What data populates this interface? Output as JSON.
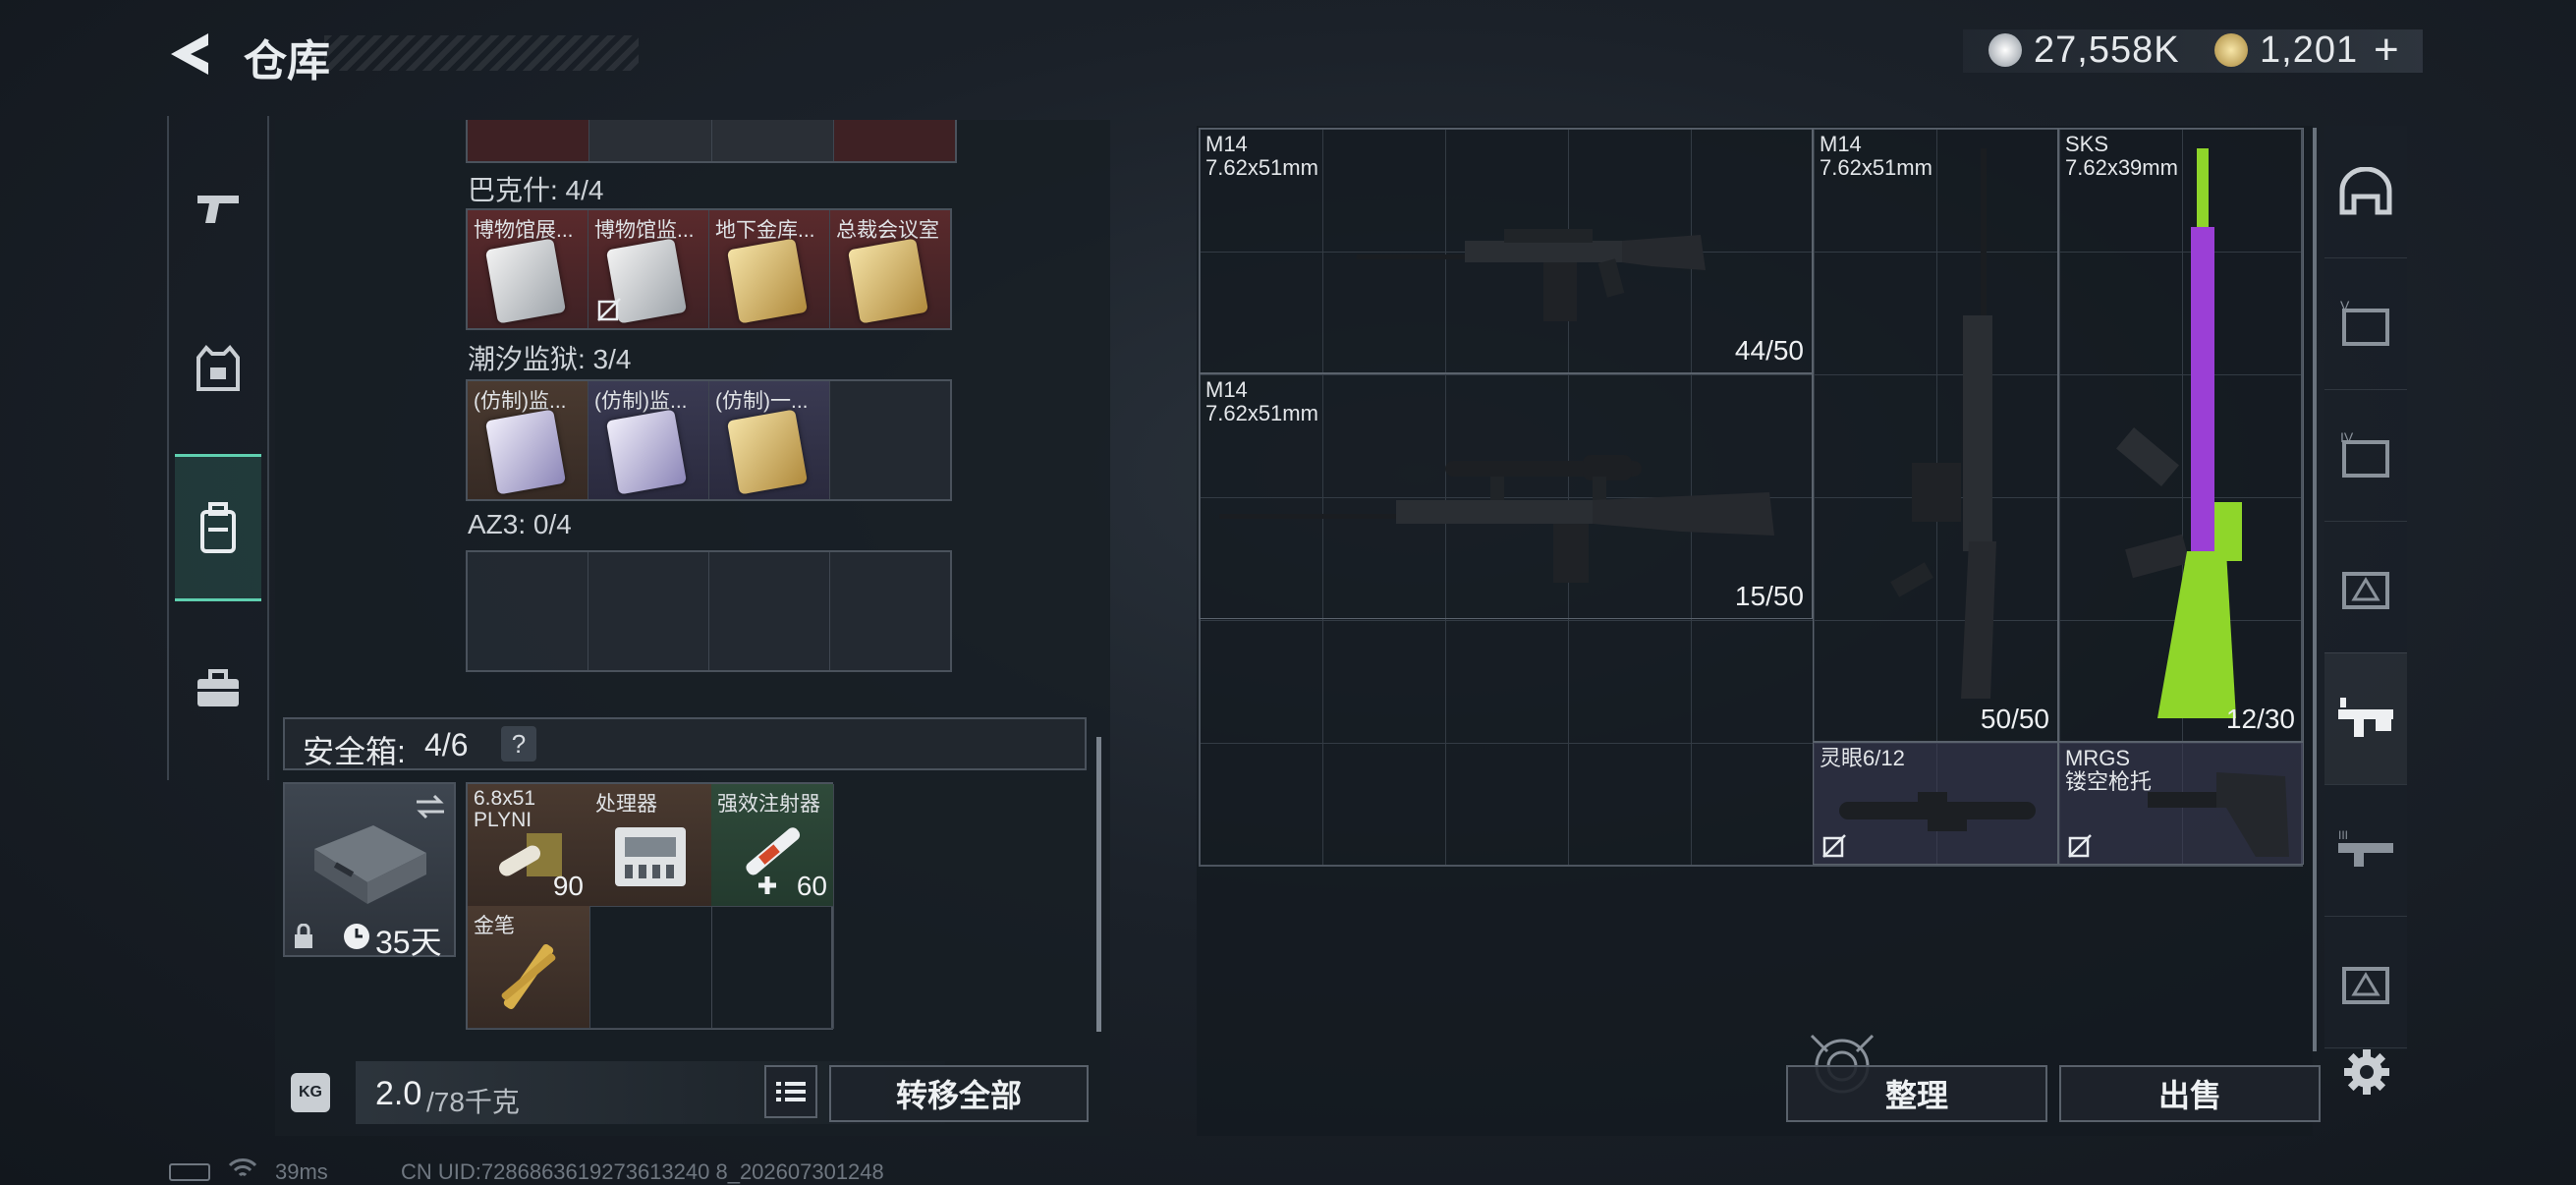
{
  "header": {
    "title": "仓库",
    "currency_silver": "27,558K",
    "currency_gold": "1,201",
    "add_symbol": "+"
  },
  "left_nav": [
    "weapon-tab",
    "armor-tab",
    "backpack-tab",
    "case-tab"
  ],
  "groups": [
    {
      "label": "巴克什: 4/4",
      "slots": [
        {
          "name": "博物馆展...",
          "color": "red",
          "card": "silver",
          "nolock": false
        },
        {
          "name": "博物馆监...",
          "color": "red",
          "card": "silver",
          "nolock": true
        },
        {
          "name": "地下金库...",
          "color": "red",
          "card": "gold",
          "nolock": false
        },
        {
          "name": "总裁会议室",
          "color": "red",
          "card": "gold",
          "nolock": false
        }
      ]
    },
    {
      "label": "潮汐监狱: 3/4",
      "slots": [
        {
          "name": "(仿制)监...",
          "color": "brown",
          "card": "lilac",
          "nolock": false
        },
        {
          "name": "(仿制)监...",
          "color": "purple",
          "card": "lilac",
          "nolock": false
        },
        {
          "name": "(仿制)一...",
          "color": "purple",
          "card": "gold",
          "nolock": false
        },
        {
          "name": "",
          "color": "empty",
          "card": "",
          "nolock": false
        }
      ]
    },
    {
      "label": "AZ3: 0/4",
      "slots": [
        {
          "name": "",
          "color": "empty",
          "card": "",
          "nolock": false
        },
        {
          "name": "",
          "color": "empty",
          "card": "",
          "nolock": false
        },
        {
          "name": "",
          "color": "empty",
          "card": "",
          "nolock": false
        },
        {
          "name": "",
          "color": "empty",
          "card": "",
          "nolock": false
        }
      ]
    }
  ],
  "safe": {
    "label": "安全箱:",
    "count": "4/6",
    "help": "?",
    "days": "35天",
    "items": [
      {
        "name": "6.8x51 PLYNI",
        "qty": "90"
      },
      {
        "name": "处理器",
        "qty": ""
      },
      {
        "name": "强效注射器",
        "qty": "60"
      },
      {
        "name": "金笔",
        "qty": ""
      }
    ]
  },
  "weight": {
    "value": "2.0",
    "unit": "/78千克",
    "transfer_all": "转移全部",
    "kg_icon_text": "KG"
  },
  "stash_items": [
    {
      "name": "M14",
      "caliber": "7.62x51mm",
      "count": "44/50"
    },
    {
      "name": "M14",
      "caliber": "7.62x51mm",
      "count": "15/50"
    },
    {
      "name": "M14",
      "caliber": "7.62x51mm",
      "count": "50/50"
    },
    {
      "name": "SKS",
      "caliber": "7.62x39mm",
      "count": "12/30"
    },
    {
      "name": "灵眼6/12",
      "caliber": "",
      "count": ""
    },
    {
      "name": "MRGS",
      "caliber": "镂空枪托",
      "count": ""
    }
  ],
  "actions": {
    "sort": "整理",
    "sell": "出售"
  },
  "status": {
    "ping": "39ms",
    "uid": "CN UID:7286863619273613240 8_202607301248"
  },
  "colors": {
    "accent": "#5fd0b0",
    "sks_purple": "#9b3fd6",
    "sks_green": "#8fd62a"
  }
}
